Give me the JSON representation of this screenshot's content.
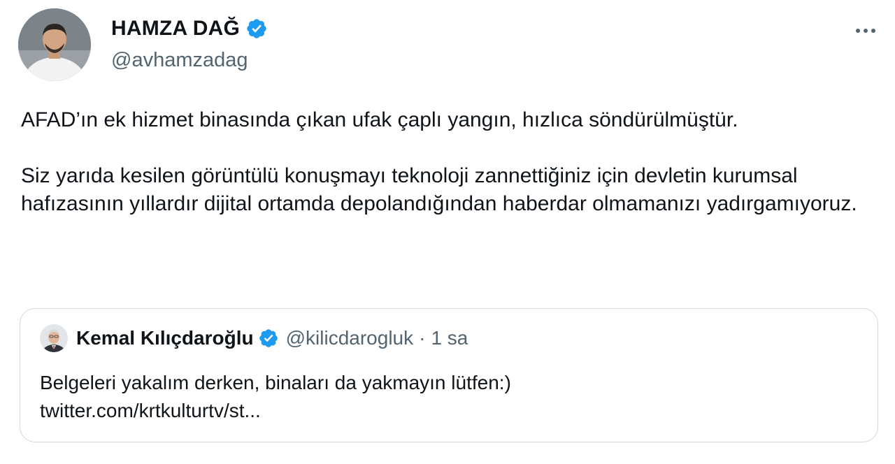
{
  "author": {
    "display_name": "HAMZA DAĞ",
    "handle": "@avhamzadag",
    "verified": true,
    "avatar_icon": "user-avatar"
  },
  "menu": {
    "icon": "more-horizontal-icon"
  },
  "tweet": {
    "paragraphs": [
      "AFAD’ın ek hizmet binasında çıkan ufak çaplı yangın, hızlıca söndürülmüştür.",
      "Siz yarıda kesilen görüntülü konuşmayı teknoloji zannettiğiniz için devletin kurumsal hafızasının yıllardır dijital ortamda depolandığından haberdar olmamanızı yadırgamıyoruz."
    ]
  },
  "quoted": {
    "display_name": "Kemal Kılıçdaroğlu",
    "handle": "@kilicdarogluk",
    "separator": "·",
    "time": "1 sa",
    "verified": true,
    "text_line1": "Belgeleri yakalım derken, binaları da yakmayın lütfen:)",
    "text_line2": "twitter.com/krtkulturtv/st..."
  },
  "colors": {
    "verified_badge": "#1d9bf0",
    "text_primary": "#0f1419",
    "text_secondary": "#536471",
    "border": "#cfd9de"
  }
}
